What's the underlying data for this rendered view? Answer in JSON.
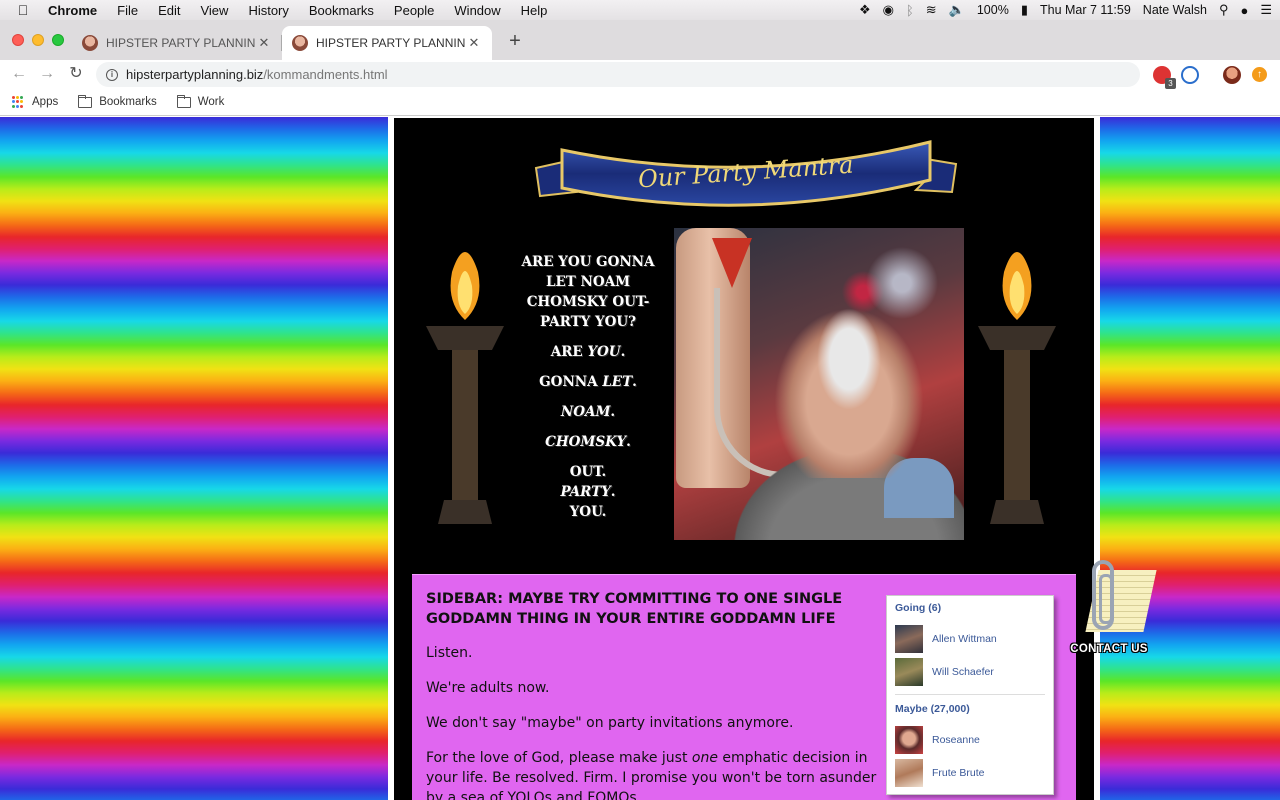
{
  "menubar": {
    "app": "Chrome",
    "items": [
      "File",
      "Edit",
      "View",
      "History",
      "Bookmarks",
      "People",
      "Window",
      "Help"
    ],
    "battery": "100%",
    "datetime": "Thu Mar 7  11:59",
    "user": "Nate Walsh"
  },
  "tabs": [
    {
      "title": "HIPSTER PARTY PLANNING DOT BIZ"
    },
    {
      "title": "HIPSTER PARTY PLANNING DOT BIZ"
    }
  ],
  "toolbar": {
    "url_host": "hipsterpartyplanning.biz",
    "url_path": "/kommandments.html",
    "ext_badge": "3"
  },
  "bookmarks": {
    "apps": "Apps",
    "bookmarks": "Bookmarks",
    "work": "Work"
  },
  "page": {
    "banner_text": "Our Party Mantra",
    "mantra": {
      "intro": "ARE YOU GONNA LET NOAM CHOMSKY OUT-PARTY YOU?",
      "l1a": "ARE ",
      "l1b": "YOU",
      "l1c": ".",
      "l2a": "GONNA ",
      "l2b": "LET",
      "l2c": ".",
      "l3b": "NOAM",
      "l3c": ".",
      "l4b": "CHOMSKY",
      "l4c": ".",
      "l5a": "OUT.",
      "l5b": "PARTY",
      "l5c": ".",
      "l5d": "YOU."
    },
    "sidebar": {
      "heading": "SIDEBAR: MAYBE TRY COMMITTING TO ONE SINGLE GODDAMN THING IN YOUR ENTIRE GODDAMN LIFE",
      "p1": "Listen.",
      "p2": "We're adults now.",
      "p3": "We don't say \"maybe\" on party invitations anymore.",
      "p4a": "For the love of God, please make just ",
      "p4b": "one",
      "p4c": " emphatic decision in your life. Be resolved. Firm. I promise you won't be torn asunder by a sea of YOLOs and FOMOs."
    },
    "rsvp": {
      "going_label": "Going (6)",
      "going": [
        "Allen Wittman",
        "Will Schaefer"
      ],
      "maybe_label": "Maybe (27,000)",
      "maybe": [
        "Roseanne",
        "Frute Brute"
      ]
    },
    "contact_label": "CONTACT US"
  },
  "colors": {
    "page_pink": "#e066f0",
    "fb_blue": "#3b5998"
  }
}
